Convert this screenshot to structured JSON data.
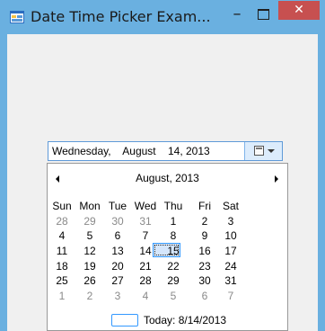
{
  "window": {
    "title": "Date Time Picker Exam...",
    "minimize_label": "–",
    "close_label": "✕"
  },
  "picker": {
    "value_text": "Wednesday,    August    14, 2013"
  },
  "calendar": {
    "month_title": "August, 2013",
    "weekdays": [
      "Sun",
      "Mon",
      "Tue",
      "Wed",
      "Thu",
      "Fri",
      "Sat"
    ],
    "weeks": [
      [
        "28",
        "29",
        "30",
        "31",
        "1",
        "2",
        "3"
      ],
      [
        "4",
        "5",
        "6",
        "7",
        "8",
        "9",
        "10"
      ],
      [
        "11",
        "12",
        "13",
        "14",
        "15",
        "16",
        "17"
      ],
      [
        "18",
        "19",
        "20",
        "21",
        "22",
        "23",
        "24"
      ],
      [
        "25",
        "26",
        "27",
        "28",
        "29",
        "30",
        "31"
      ],
      [
        "1",
        "2",
        "3",
        "4",
        "5",
        "6",
        "7"
      ]
    ],
    "selected_day": "14",
    "today_label": "Today: 8/14/2013"
  },
  "colors": {
    "titlebar": "#6ab0e0",
    "close_button": "#c75050",
    "selection_border": "#3399ff",
    "selection_fill": "#d5e6fb",
    "other_month_text": "#8a8a8a"
  }
}
